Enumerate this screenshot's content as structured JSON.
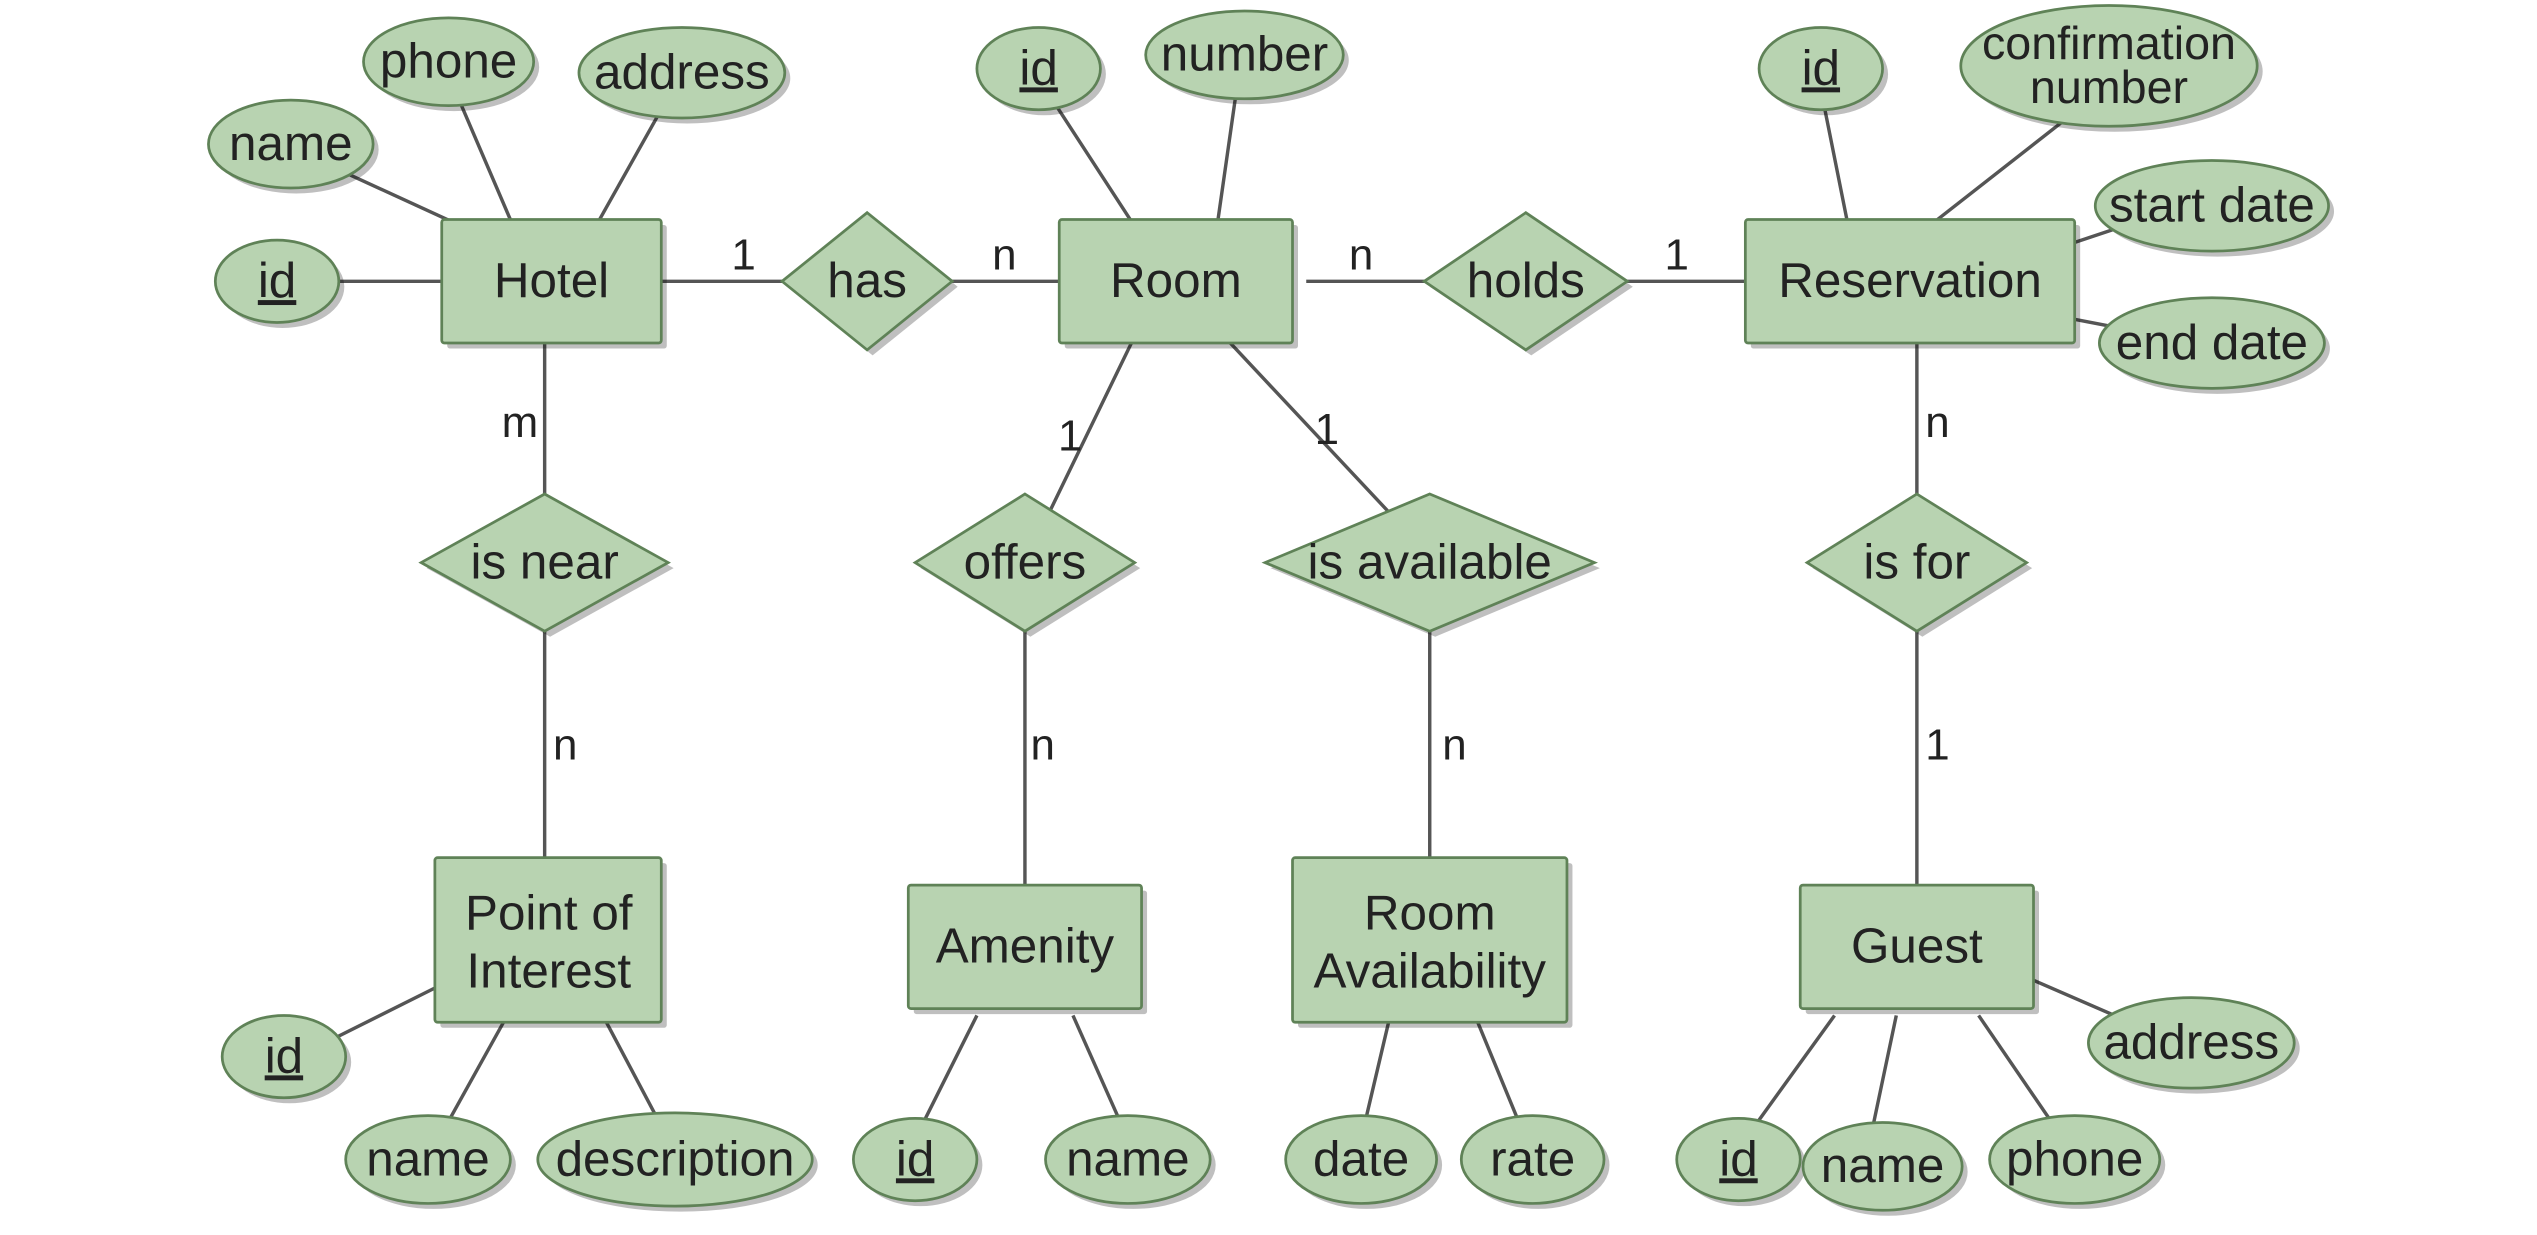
{
  "entities": {
    "hotel": "Hotel",
    "room": "Room",
    "reservation": "Reservation",
    "poi_l1": "Point of",
    "poi_l2": "Interest",
    "amenity": "Amenity",
    "roomavail_l1": "Room",
    "roomavail_l2": "Availability",
    "guest": "Guest"
  },
  "relationships": {
    "has": "has",
    "holds": "holds",
    "is_near": "is near",
    "offers": "offers",
    "is_available": "is available",
    "is_for": "is for"
  },
  "attributes": {
    "hotel_id": "id",
    "hotel_name": "name",
    "hotel_phone": "phone",
    "hotel_address": "address",
    "room_id": "id",
    "room_number": "number",
    "res_id": "id",
    "res_conf_l1": "confirmation",
    "res_conf_l2": "number",
    "res_start": "start date",
    "res_end": "end date",
    "poi_id": "id",
    "poi_name": "name",
    "poi_desc": "description",
    "amenity_id": "id",
    "amenity_name": "name",
    "ra_date": "date",
    "ra_rate": "rate",
    "guest_id": "id",
    "guest_name": "name",
    "guest_phone": "phone",
    "guest_address": "address"
  },
  "cardinalities": {
    "hotel_has": "1",
    "has_room": "n",
    "room_holds": "n",
    "holds_res": "1",
    "hotel_isnear": "m",
    "isnear_poi": "n",
    "room_offers": "1",
    "offers_amenity": "n",
    "room_isavail": "1",
    "isavail_ra": "n",
    "res_isfor": "n",
    "isfor_guest": "1"
  }
}
